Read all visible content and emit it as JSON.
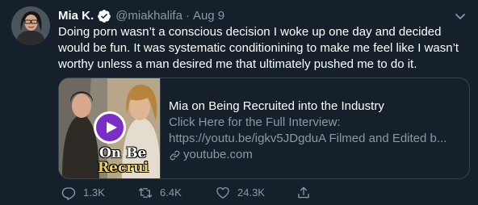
{
  "tweet": {
    "display_name": "Mia K.",
    "verified": true,
    "handle": "@miakhalifa",
    "separator": "·",
    "time": "Aug 9",
    "text": "Doing porn wasn’t a conscious decision I woke up one day and decided would be fun. It was systematic conditionining to make me feel like I wasn’t worthy unless a man desired me that ultimately pushed me to do it."
  },
  "card": {
    "title": "Mia on Being Recruited into the Industry",
    "description_line1": "Click Here for the Full Interview:",
    "description_line2": "https://youtu.be/igkv5JDgduA Filmed and Edited b...",
    "domain": "youtube.com",
    "thumbnail_text_line1": "On Be",
    "thumbnail_text_line2": "Recrui"
  },
  "actions": {
    "reply_count": "1.3K",
    "retweet_count": "6.4K",
    "like_count": "24.3K"
  },
  "colors": {
    "background": "#15202b",
    "secondary_text": "#8899a6",
    "verified_blue": "#1da1f2",
    "border": "#38444d",
    "play_button": "#7b2ec7"
  },
  "icons": {
    "more": "chevron-down-icon",
    "verified": "verified-badge-icon",
    "play": "play-icon",
    "link": "link-icon",
    "reply": "reply-icon",
    "retweet": "retweet-icon",
    "like": "heart-icon",
    "share": "share-icon"
  }
}
